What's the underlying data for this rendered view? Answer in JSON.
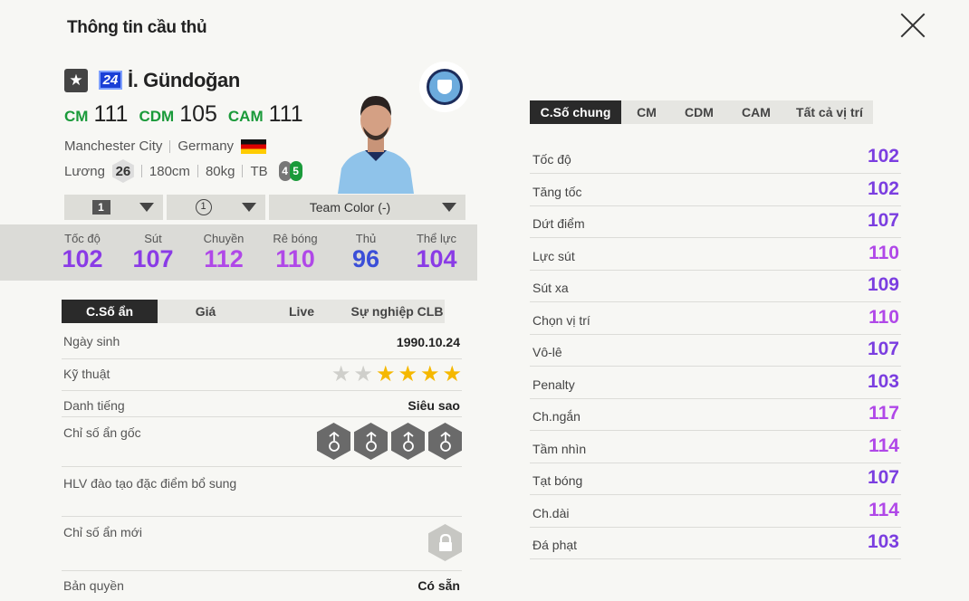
{
  "header": {
    "title": "Thông tin cầu thủ"
  },
  "player": {
    "season_number": "24",
    "name": "İ. Gündoğan",
    "positions": [
      {
        "code": "CM",
        "ovr": "111"
      },
      {
        "code": "CDM",
        "ovr": "105"
      },
      {
        "code": "CAM",
        "ovr": "111"
      }
    ],
    "club": "Manchester City",
    "nation": "Germany",
    "salary_label": "Lương",
    "salary": "26",
    "height": "180cm",
    "weight": "80kg",
    "body_type": "TB",
    "weak_foot": "4",
    "strong_foot": "5"
  },
  "selectors": {
    "level": "1",
    "team_count": "1",
    "team_color": "Team Color (-)"
  },
  "summary_stats": [
    {
      "label": "Tốc độ",
      "value": "102",
      "color": "#8a3be6"
    },
    {
      "label": "Sút",
      "value": "107",
      "color": "#8a3be6"
    },
    {
      "label": "Chuyền",
      "value": "112",
      "color": "#b048e8"
    },
    {
      "label": "Rê bóng",
      "value": "110",
      "color": "#b048e8"
    },
    {
      "label": "Thủ",
      "value": "96",
      "color": "#3b4fd8"
    },
    {
      "label": "Thể lực",
      "value": "104",
      "color": "#8a3be6"
    }
  ],
  "left_tabs": [
    "C.Số ẩn",
    "Giá",
    "Live",
    "Sự nghiệp CLB"
  ],
  "info": {
    "birthday_label": "Ngày sinh",
    "birthday": "1990.10.24",
    "skill_label": "Kỹ thuật",
    "skill_stars": 4,
    "skill_stars_max": 6,
    "reputation_label": "Danh tiếng",
    "reputation": "Siêu sao",
    "traits_label": "Chỉ số ẩn gốc",
    "coach_label": "HLV đào tạo đặc điểm bổ sung",
    "new_traits_label": "Chỉ số ẩn mới",
    "license_label": "Bản quyền",
    "license": "Có sẵn"
  },
  "trait_icons": [
    "power-header-trait-icon",
    "swerve-trait-icon",
    "playmaker-trait-icon",
    "long-shot-trait-icon"
  ],
  "right_tabs": [
    "C.Số chung",
    "CM",
    "CDM",
    "CAM",
    "Tất cả vị trí"
  ],
  "attributes": [
    {
      "name": "Tốc độ",
      "value": "102",
      "color": "#7b3ee0"
    },
    {
      "name": "Tăng tốc",
      "value": "102",
      "color": "#7b3ee0"
    },
    {
      "name": "Dứt điểm",
      "value": "107",
      "color": "#7b3ee0"
    },
    {
      "name": "Lực sút",
      "value": "110",
      "color": "#b048e8"
    },
    {
      "name": "Sút xa",
      "value": "109",
      "color": "#7b3ee0"
    },
    {
      "name": "Chọn vị trí",
      "value": "110",
      "color": "#b048e8"
    },
    {
      "name": "Vô-lê",
      "value": "107",
      "color": "#7b3ee0"
    },
    {
      "name": "Penalty",
      "value": "103",
      "color": "#7b3ee0"
    },
    {
      "name": "Ch.ngắn",
      "value": "117",
      "color": "#b048e8"
    },
    {
      "name": "Tầm nhìn",
      "value": "114",
      "color": "#b048e8"
    },
    {
      "name": "Tạt bóng",
      "value": "107",
      "color": "#7b3ee0"
    },
    {
      "name": "Ch.dài",
      "value": "114",
      "color": "#b048e8"
    },
    {
      "name": "Đá phạt",
      "value": "103",
      "color": "#7b3ee0"
    }
  ]
}
